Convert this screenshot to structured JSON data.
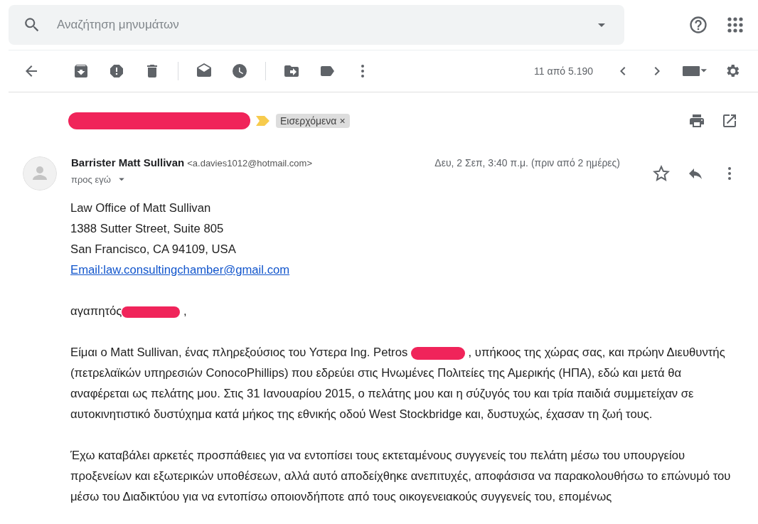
{
  "search": {
    "placeholder": "Αναζήτηση μηνυμάτων"
  },
  "toolbar": {
    "counter": "11 από 5.190"
  },
  "message": {
    "label": "Εισερχόμενα",
    "label_close": "×",
    "sender_name": "Barrister Matt Sullivan",
    "sender_email": "<a.davies1012@hotmail.com>",
    "recipient": "προς εγώ",
    "date": "Δευ, 2 Σεπ, 3:40 π.μ. (πριν από 2 ημέρες)",
    "starred": false
  },
  "body": {
    "address_lines": [
      "Law Office of Matt Sullivan",
      "1388 Sutter Street, Suite 805",
      "San Francisco, CA 94109, USA"
    ],
    "email_link": "Email:law.consultingchamber@gmail.com",
    "greeting": {
      "before": "αγαπητός",
      "after": ","
    },
    "paragraph_1": {
      "before": "Είμαι ο Matt Sullivan, ένας πληρεξούσιος του Υστερα Ing. Petros",
      "after": ", υπήκοος της χώρας σας, και πρώην Διευθυντής (πετρελαϊκών υπηρεσιών ConocoPhillips) που εδρεύει στις Ηνωμένες Πολιτείες της Αμερικής (ΗΠΑ), εδώ και μετά θα αναφέρεται ως πελάτης μου. Στις 31 Ιανουαρίου 2015, ο πελάτης μου και η σύζυγός του και τρία παιδιά συμμετείχαν σε αυτοκινητιστικό δυστύχημα κατά μήκος της εθνικής οδού West Stockbridge και, δυστυχώς, έχασαν τη ζωή τους."
    },
    "paragraph_2": "Έχω καταβάλει αρκετές προσπάθειες για να εντοπίσει τους εκτεταμένους συγγενείς του πελάτη μέσω του υπουργείου προξενείων και εξωτερικών υποθέσεων, αλλά αυτό αποδείχθηκε ανεπιτυχές, αποφάσισα να παρακολουθήσω το επώνυμό του μέσω του Διαδικτύου για να εντοπίσω οποιονδήποτε από τους οικογενειακούς συγγενείς του, επομένως"
  }
}
